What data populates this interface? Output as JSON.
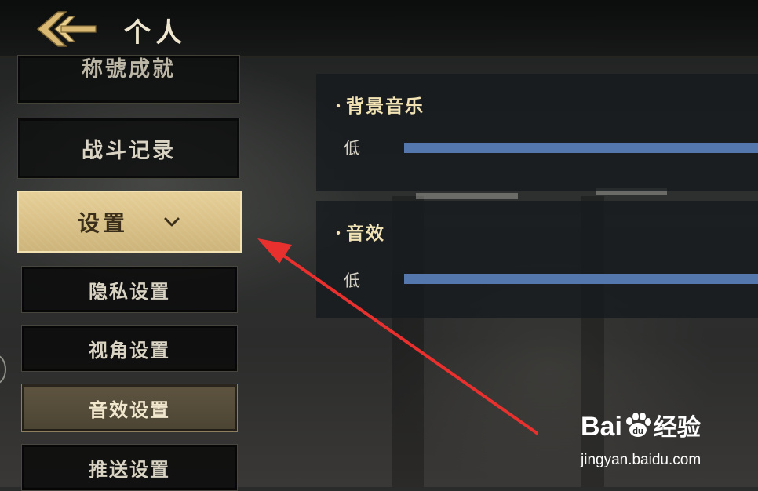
{
  "header": {
    "title": "个人"
  },
  "menu": {
    "partial_item_label": "称號成就",
    "battle_record_label": "战斗记录",
    "settings_label": "设置",
    "submenu": [
      {
        "label": "隐私设置",
        "active": false
      },
      {
        "label": "视角设置",
        "active": false
      },
      {
        "label": "音效设置",
        "active": true
      },
      {
        "label": "推送设置",
        "active": false
      }
    ]
  },
  "settings": {
    "music": {
      "title": "背景音乐",
      "low_label": "低",
      "level": 1.0
    },
    "sound_effects": {
      "title": "音效",
      "low_label": "低",
      "level": 1.0
    }
  },
  "watermark": {
    "brand_part1": "Bai",
    "brand_part2": "经验",
    "url": "jingyan.baidu.com"
  },
  "colors": {
    "gold_accent": "#e6cf98",
    "slider_blue": "#5478ad",
    "annotation_red": "#e8312f"
  }
}
